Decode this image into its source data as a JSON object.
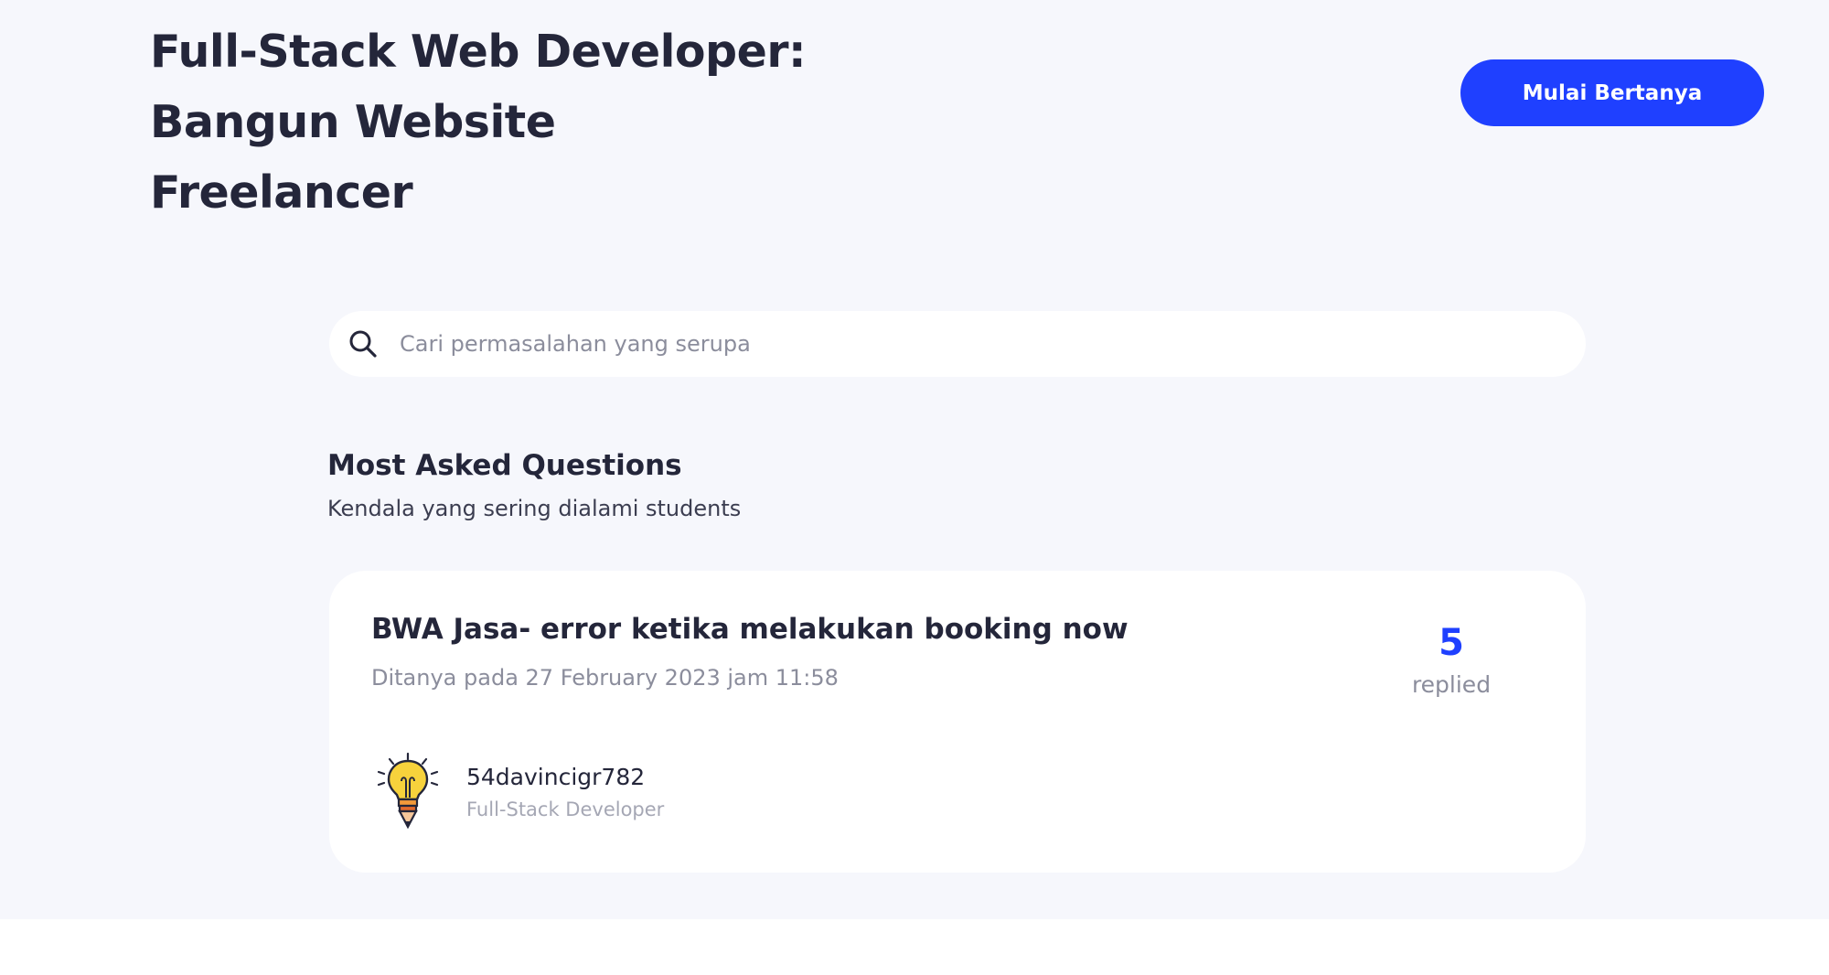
{
  "course": {
    "title_line1": "Full-Stack Web Developer:",
    "title_line2": "Bangun Website",
    "title_line3": "Freelancer"
  },
  "header": {
    "ask_button_label": "Mulai Bertanya"
  },
  "search": {
    "placeholder": "Cari permasalahan yang serupa",
    "value": "",
    "icon": "search-icon"
  },
  "section": {
    "title": "Most Asked Questions",
    "subtitle": "Kendala yang sering dialami students"
  },
  "questions": [
    {
      "title": "BWA Jasa- error ketika melakukan booking now",
      "meta": "Ditanya pada 27 February 2023 jam 11:58",
      "reply_count": "5",
      "reply_label": "replied",
      "author": {
        "name": "54davincigr782",
        "role": "Full-Stack Developer",
        "avatar_icon": "lightbulb-pencil-icon"
      }
    }
  ],
  "colors": {
    "page_background": "#f6f7fc",
    "primary": "#1f40ff",
    "text_dark": "#24263a",
    "text_muted": "#8b8d9c"
  }
}
